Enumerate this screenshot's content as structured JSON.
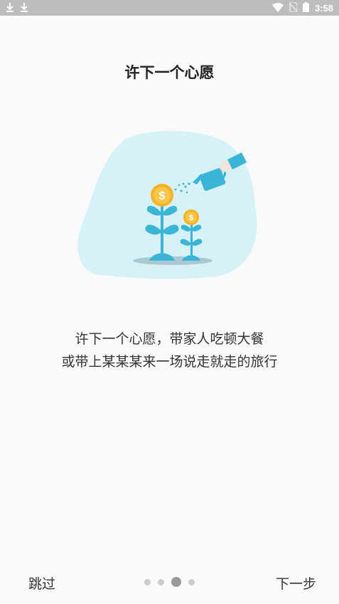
{
  "status_bar": {
    "time": "3:58",
    "left_icons": [
      "download-icon",
      "download-icon"
    ],
    "right_icons": [
      "wifi-icon",
      "no-sim-icon",
      "battery-icon"
    ]
  },
  "page": {
    "title": "许下一个心愿",
    "description_line1": "许下一个心愿，带家人吃顿大餐",
    "description_line2": "或带上某某某来一场说走就走的旅行"
  },
  "illustration": {
    "name": "money-plants-watering-illustration",
    "coin_symbol_large": "$",
    "coin_symbol_small": "$"
  },
  "bottom_bar": {
    "skip_label": "跳过",
    "next_label": "下一步",
    "page_count": 4,
    "active_page": 3
  },
  "colors": {
    "blob": "#d6f2f8",
    "leaf": "#3bb5d6",
    "coin": "#f5b321",
    "status_bar": "#bdbdbd"
  }
}
